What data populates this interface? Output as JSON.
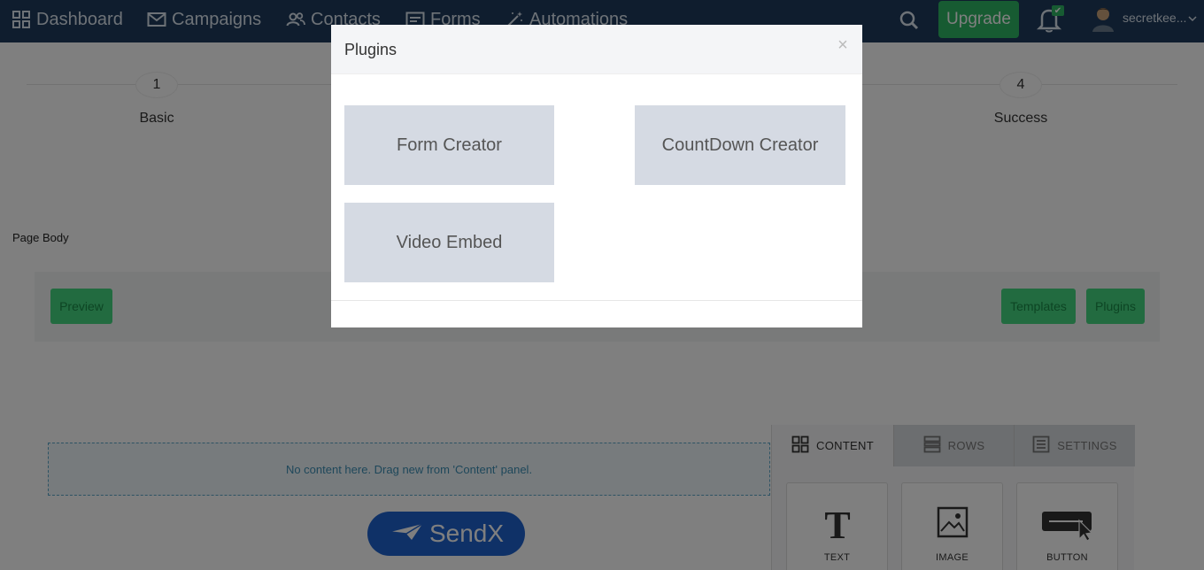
{
  "nav": {
    "items": [
      {
        "label": "Dashboard",
        "icon": "grid-icon"
      },
      {
        "label": "Campaigns",
        "icon": "envelope-icon"
      },
      {
        "label": "Contacts",
        "icon": "users-icon"
      },
      {
        "label": "Forms",
        "icon": "form-icon"
      },
      {
        "label": "Automations",
        "icon": "magic-wand-icon"
      }
    ],
    "upgrade_label": "Upgrade",
    "username": "secretkee...",
    "bell_badge": "✔"
  },
  "steps": [
    {
      "num": "1",
      "label": "Basic"
    },
    {
      "num": "4",
      "label": "Success"
    }
  ],
  "page_body_label": "Page Body",
  "toolbar": {
    "preview_label": "Preview",
    "templates_label": "Templates",
    "plugins_label": "Plugins"
  },
  "editor": {
    "drop_zone_text": "No content here. Drag new from 'Content' panel.",
    "logo_text": "SendX"
  },
  "panel": {
    "tabs": [
      {
        "label": "CONTENT"
      },
      {
        "label": "ROWS"
      },
      {
        "label": "SETTINGS"
      }
    ],
    "blocks": [
      {
        "label": "TEXT",
        "icon": "text-icon"
      },
      {
        "label": "IMAGE",
        "icon": "image-icon"
      },
      {
        "label": "BUTTON",
        "icon": "button-icon"
      }
    ]
  },
  "modal": {
    "title": "Plugins",
    "close": "×",
    "plugins": [
      {
        "label": "Form Creator"
      },
      {
        "label": "CountDown Creator"
      },
      {
        "label": "Video Embed"
      }
    ]
  },
  "colors": {
    "nav_bg": "#1e3a5c",
    "accent_green": "#2fb765",
    "plugin_card": "#d5dae3",
    "logo_blue": "#1f63cf"
  }
}
